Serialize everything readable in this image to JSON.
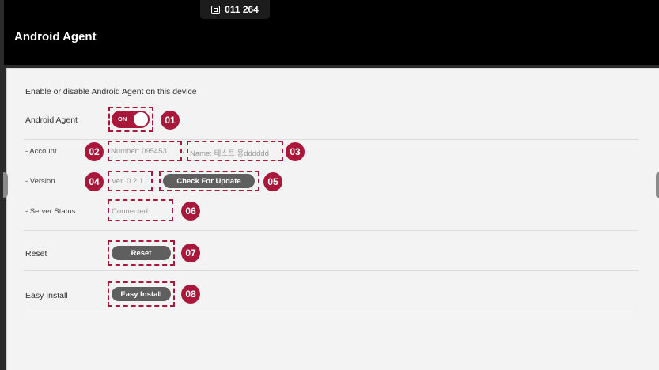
{
  "header": {
    "channel_number": "011 264",
    "title": "Android Agent"
  },
  "content": {
    "description": "Enable or disable Android Agent on this device",
    "android_agent": {
      "label": "Android Agent",
      "toggle_state": "ON"
    },
    "account": {
      "label": "- Account",
      "number": "Number: 095453",
      "separator": "/",
      "name": "Name: 테스트 용dddddd"
    },
    "version": {
      "label": "- Version",
      "value": "Ver. 0.2.1",
      "button": "Check For Update"
    },
    "server_status": {
      "label": "- Server Status",
      "value": "Connected"
    },
    "reset": {
      "label": "Reset",
      "button": "Reset"
    },
    "easy_install": {
      "label": "Easy Install",
      "button": "Easy Install"
    }
  },
  "callouts": [
    "01",
    "02",
    "03",
    "04",
    "05",
    "06",
    "07",
    "08"
  ],
  "colors": {
    "accent": "#a9183a",
    "header_bg": "#000000",
    "panel_bg": "#f3f3f3",
    "button_bg": "#5f5f5f"
  }
}
